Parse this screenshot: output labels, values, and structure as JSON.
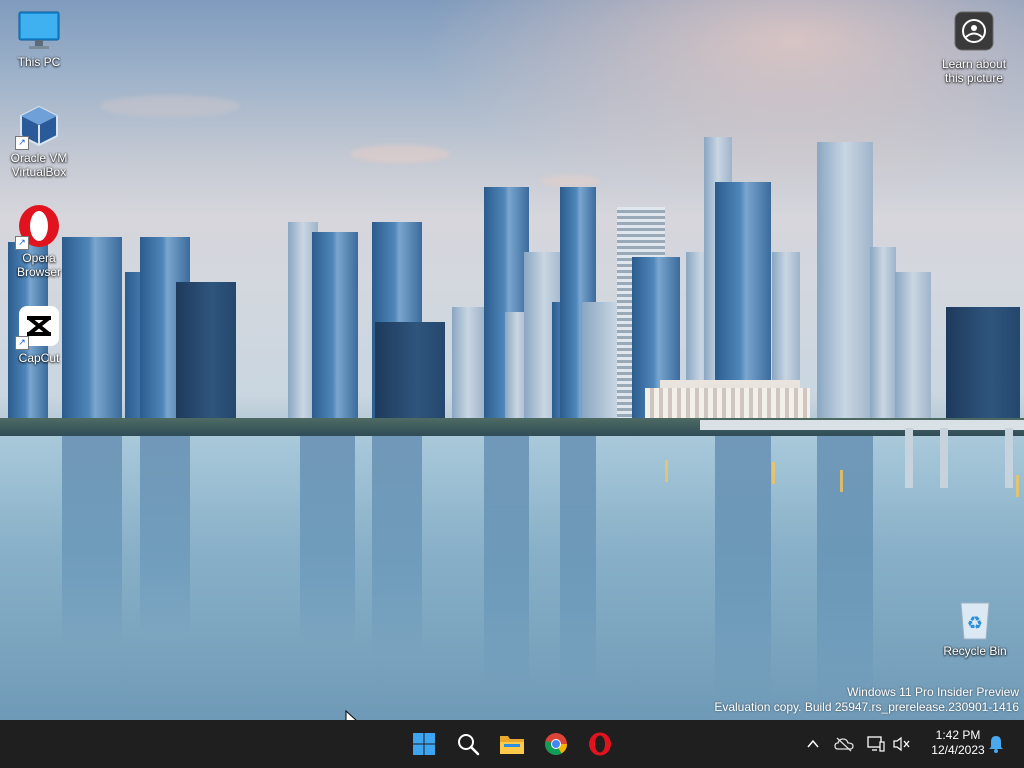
{
  "desktop": {
    "icons": [
      {
        "label": "This PC",
        "icon": "monitor-icon"
      },
      {
        "label": "Oracle VM VirtualBox",
        "icon": "virtualbox-icon"
      },
      {
        "label": "Opera Browser",
        "icon": "opera-icon"
      },
      {
        "label": "CapCut",
        "icon": "capcut-icon"
      },
      {
        "label": "Learn about this picture",
        "icon": "camera-icon"
      },
      {
        "label": "Recycle Bin",
        "icon": "recycle-bin-icon"
      }
    ],
    "watermark": {
      "line1": "Windows 11 Pro Insider Preview",
      "line2": "Evaluation copy. Build 25947.rs_prerelease.230901-1416"
    }
  },
  "taskbar": {
    "apps": [
      "windows-start-icon",
      "search-icon",
      "file-explorer-icon",
      "chrome-icon",
      "opera-icon"
    ],
    "tray": [
      "chevron-up-icon",
      "onedrive-icon",
      "network-icon",
      "volume-muted-icon",
      "notification-bell-icon"
    ],
    "clock": {
      "time": "1:42 PM",
      "date": "12/4/2023"
    }
  },
  "colors": {
    "taskbar": "#1f1f1f",
    "accent": "#0078d4"
  }
}
